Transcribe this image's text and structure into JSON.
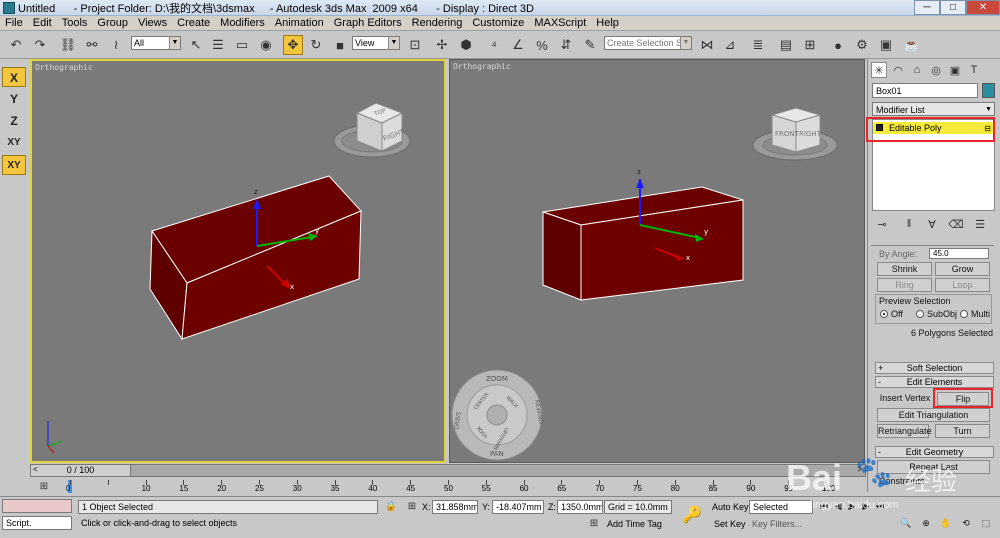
{
  "window": {
    "title": "Untitled      - Project Folder: D:\\我的文档\\3dsmax     - Autodesk 3ds Max  2009 x64      - Display : Direct 3D",
    "controls": [
      "─",
      "□",
      "✕"
    ]
  },
  "menu": [
    "File",
    "Edit",
    "Tools",
    "Group",
    "Views",
    "Create",
    "Modifiers",
    "Animation",
    "Graph Editors",
    "Rendering",
    "Customize",
    "MAXScript",
    "Help"
  ],
  "toolbar": {
    "filter_value": "All",
    "refcoord_value": "View",
    "selection_set_placeholder": "Create Selection Se"
  },
  "axis_constraints": [
    "X",
    "Y",
    "Z",
    "XY",
    "XY"
  ],
  "viewports": {
    "left": {
      "label": "Orthographic"
    },
    "right": {
      "label": "Orthographic"
    }
  },
  "viewcube": {
    "left_faces": [
      "TOP",
      "RIGHT"
    ],
    "right_faces": [
      "FRONT",
      "RIGHT"
    ]
  },
  "gizmo_labels": {
    "z": "z",
    "y": "y",
    "x": "x"
  },
  "steering_wheel": {
    "zoom": "ZOOM",
    "orbit": "ORBIT",
    "rewind": "REWIND",
    "pan": "PAN",
    "center": "CENTER",
    "walk": "WALK",
    "look": "LOOK",
    "updown": "UP/DOWN"
  },
  "command_panel": {
    "object_name": "Box01",
    "object_color": "#2a8fa0",
    "modifier_list": "Modifier List",
    "stack_item": "Editable Poly",
    "by_angle_label": "By Angle:",
    "by_angle_value": "45.0",
    "grow_shrink": {
      "shrink": "Shrink",
      "grow": "Grow"
    },
    "ring_loop": {
      "ring": "Ring",
      "loop": "Loop"
    },
    "preview_selection": {
      "title": "Preview Selection",
      "off": "Off",
      "subobj": "SubObj",
      "multi": "Multi"
    },
    "selection_info": "6 Polygons Selected",
    "soft_selection": "Soft Selection",
    "edit_elements": "Edit Elements",
    "insert_vertex": "Insert Vertex",
    "flip": "Flip",
    "edit_triangulation": "Edit Triangulation",
    "retriangulate": "Retriangulate",
    "turn": "Turn",
    "edit_geometry": "Edit Geometry",
    "repeat_last": "Repeat Last",
    "constraints": "Constraints"
  },
  "timeline": {
    "slider": "0 / 100",
    "ticks": [
      "0",
      "10",
      "15",
      "20",
      "25",
      "30",
      "35",
      "40",
      "45",
      "50",
      "55",
      "60",
      "65",
      "70",
      "75",
      "80",
      "85",
      "90",
      "95",
      "100"
    ]
  },
  "status": {
    "maxscript_label": "Script.",
    "object_selected": "1 Object Selected",
    "prompt": "Click or click-and-drag to select objects",
    "x_label": "X:",
    "x_value": "31.858mm",
    "y_label": "Y:",
    "y_value": "-18.407mm",
    "z_label": "Z:",
    "z_value": "1350.0mm",
    "grid": "Grid = 10.0mm",
    "add_time_tag": "Add Time Tag",
    "auto_key": "Auto Key",
    "set_key": "Set Key",
    "selected": "Selected",
    "key_filters": "Key Filters..."
  },
  "watermark": {
    "brand": "Bai",
    "site": "jingyan.baidu.com",
    "cn": "经验"
  }
}
